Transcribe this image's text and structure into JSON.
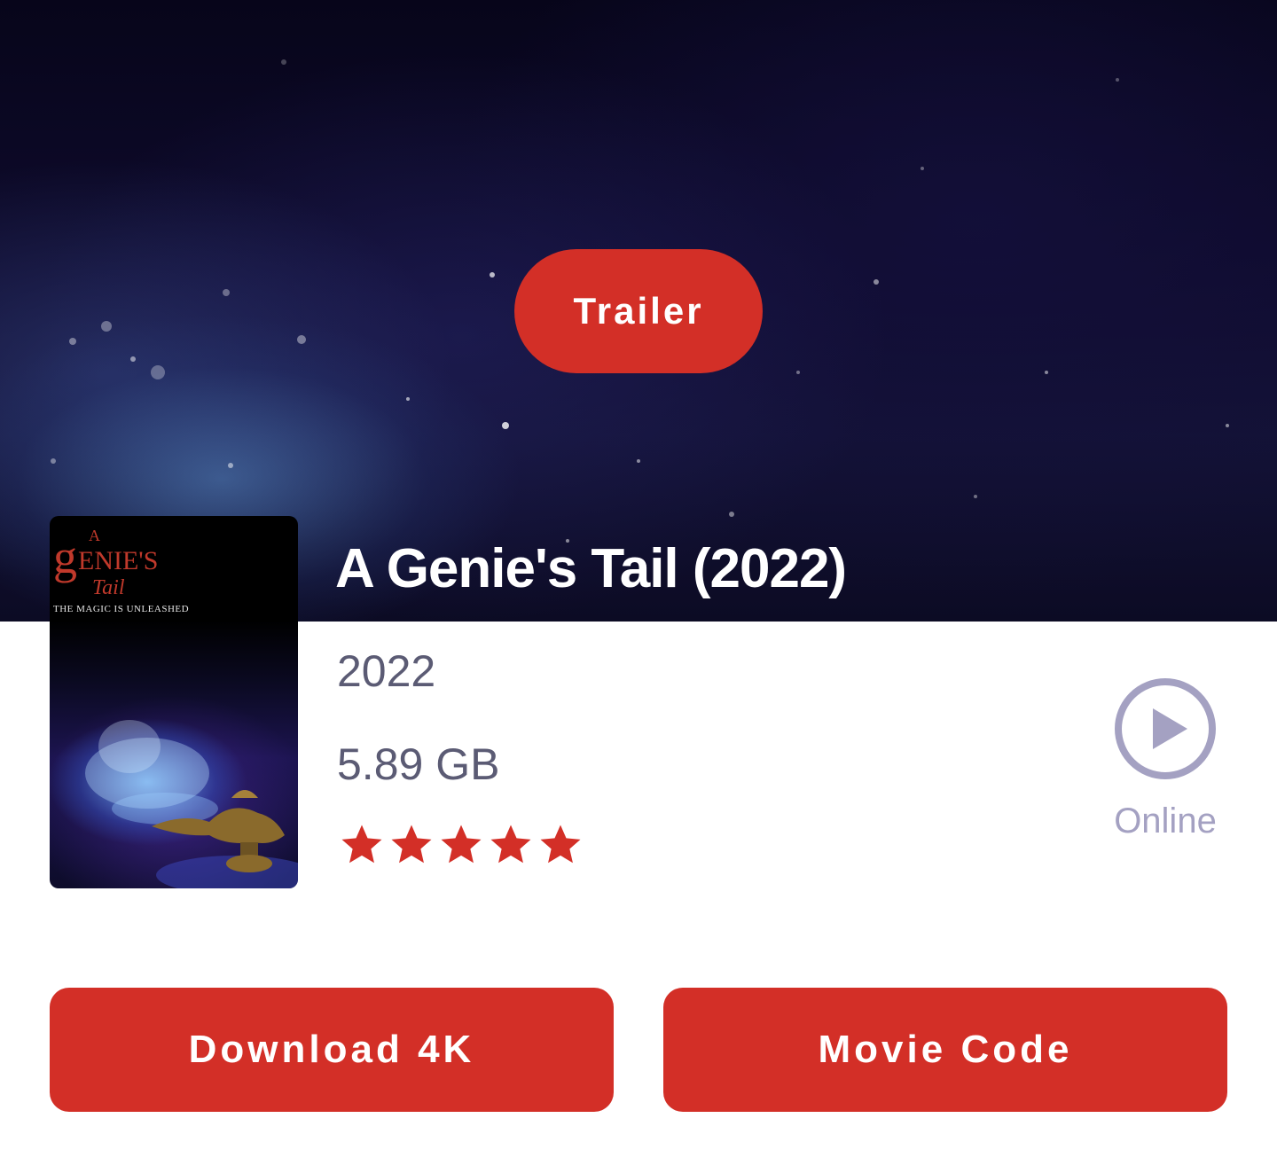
{
  "hero": {
    "trailer_label": "Trailer"
  },
  "poster": {
    "logo_text": "A GENIE'S Tail",
    "tagline": "THE MAGIC IS UNLEASHED"
  },
  "movie": {
    "title": "A Genie's Tail (2022)",
    "year": "2022",
    "size": "5.89 GB",
    "rating": 5,
    "rating_max": 5
  },
  "online": {
    "label": "Online",
    "icon": "play-circle-icon"
  },
  "actions": {
    "download_label": "Download 4K",
    "code_label": "Movie Code"
  },
  "colors": {
    "accent": "#d32f27",
    "text_muted": "#5b5b74",
    "online": "#a4a1c2",
    "background": "#ffffff"
  }
}
